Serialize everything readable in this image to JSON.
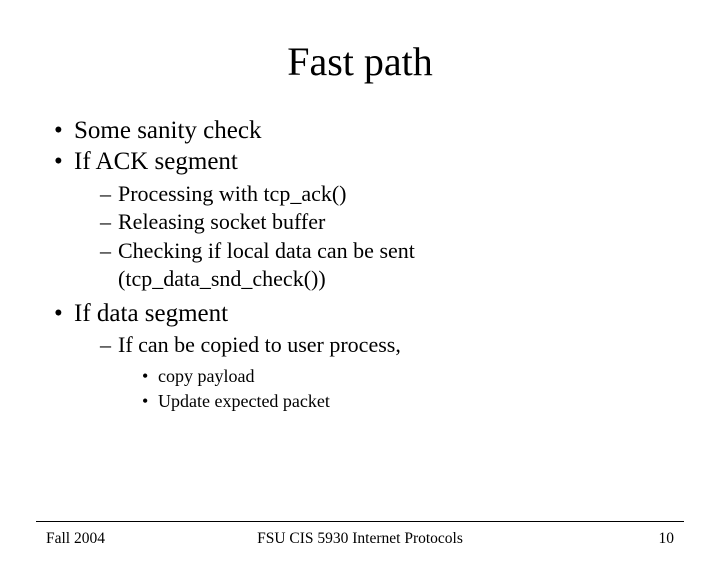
{
  "title": "Fast path",
  "bullets": {
    "item0": "Some sanity check",
    "item1": "If ACK segment",
    "item1_sub0": "Processing with tcp_ack()",
    "item1_sub1": "Releasing socket buffer",
    "item1_sub2_line1": "Checking if local data can be sent",
    "item1_sub2_line2": "(tcp_data_snd_check())",
    "item2": "If data segment",
    "item2_sub0": "If can be copied to user process,",
    "item2_sub0_sub0": "copy payload",
    "item2_sub0_sub1": "Update expected packet"
  },
  "footer": {
    "left": "Fall 2004",
    "center": "FSU CIS 5930 Internet Protocols",
    "right": "10"
  }
}
